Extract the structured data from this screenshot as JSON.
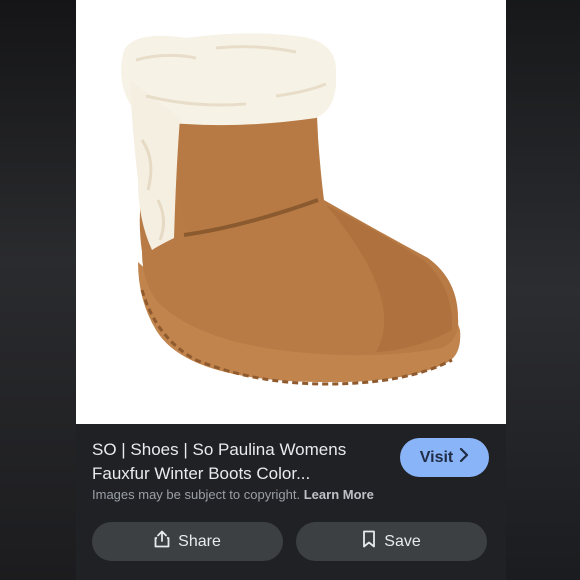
{
  "result": {
    "title_line1": "SO | Shoes | So Paulina Womens",
    "title_line2": "Fauxfur Winter Boots Color...",
    "visit_label": "Visit",
    "copyright_text": "Images may be subject to copyright.",
    "learn_more_label": "Learn More"
  },
  "actions": {
    "share_label": "Share",
    "save_label": "Save"
  },
  "icons": {
    "visit": "chevron-right-icon",
    "share": "share-icon",
    "save": "bookmark-icon"
  },
  "colors": {
    "panel_bg": "#202124",
    "visit_bg": "#8ab4f8",
    "action_bg": "#3c4043",
    "boot": "#b87b45",
    "fur": "#f7f2e6"
  }
}
